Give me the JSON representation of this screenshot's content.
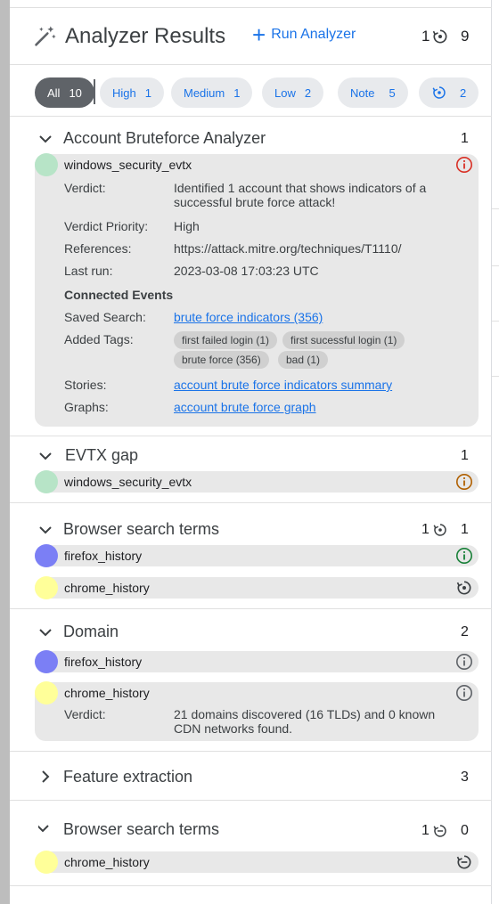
{
  "header": {
    "title": "Analyzer Results",
    "run_label": "Run Analyzer",
    "running_count": "1",
    "total_count": "9"
  },
  "filters": [
    {
      "label": "All",
      "count": "10",
      "active": true
    },
    {
      "label": "High",
      "count": "1"
    },
    {
      "label": "Medium",
      "count": "1"
    },
    {
      "label": "Low",
      "count": "2"
    },
    {
      "label": "Note",
      "count": "5"
    },
    {
      "label": "",
      "count": "2",
      "icon": "running-icon"
    }
  ],
  "sections": [
    {
      "title": "Account Bruteforce Analyzer",
      "count": "1",
      "expanded": true,
      "rows": [
        {
          "name": "windows_security_evtx",
          "dot_color": "#b7e4c7",
          "status_icon": "info-high-icon",
          "details": {
            "verdict_label": "Verdict:",
            "verdict": "Identified 1 account that shows indicators of a successful brute force attack!",
            "priority_label": "Verdict Priority:",
            "priority": "High",
            "references_label": "References:",
            "references": "https://attack.mitre.org/techniques/T1110/",
            "last_run_label": "Last run:",
            "last_run": "2023-03-08 17:03:23 UTC",
            "connected_events": "Connected Events",
            "saved_search_label": "Saved Search:",
            "saved_search": "brute force indicators (356)",
            "added_tags_label": "Added Tags:",
            "tags": [
              "first failed login (1)",
              "first sucessful login (1)",
              "brute force (356)",
              "bad (1)"
            ],
            "stories_label": "Stories:",
            "stories": "account brute force indicators summary",
            "graphs_label": "Graphs:",
            "graphs": "account brute force graph"
          }
        }
      ]
    },
    {
      "title": "EVTX gap",
      "count": "1",
      "expanded": true,
      "rows": [
        {
          "name": "windows_security_evtx",
          "dot_color": "#b7e4c7",
          "status_icon": "info-medium-icon"
        }
      ]
    },
    {
      "title": "Browser search terms",
      "count_running": "1",
      "count": "1",
      "expanded": true,
      "rows": [
        {
          "name": "firefox_history",
          "dot_color": "#7b7ff5",
          "status_icon": "info-low-icon"
        },
        {
          "name": "chrome_history",
          "dot_color": "#ffff99",
          "status_icon": "running-icon"
        }
      ]
    },
    {
      "title": "Domain",
      "count": "2",
      "expanded": true,
      "rows": [
        {
          "name": "firefox_history",
          "dot_color": "#7b7ff5",
          "status_icon": "info-note-icon"
        },
        {
          "name": "chrome_history",
          "dot_color": "#ffff99",
          "status_icon": "info-note-icon",
          "details": {
            "verdict_label": "Verdict:",
            "verdict": "21 domains discovered (16 TLDs) and 0 known CDN networks found."
          }
        }
      ]
    },
    {
      "title": "Feature extraction",
      "count": "3",
      "expanded": false
    },
    {
      "title": "Browser search terms",
      "count_running": "1",
      "count": "0",
      "expanded": true,
      "rows": [
        {
          "name": "chrome_history",
          "dot_color": "#ffff99",
          "status_icon": "pending-icon"
        }
      ]
    }
  ],
  "colors": {
    "accent": "#1a73e8",
    "high": "#d93025",
    "medium": "#b06000",
    "low": "#188038",
    "note": "#5f6368"
  }
}
